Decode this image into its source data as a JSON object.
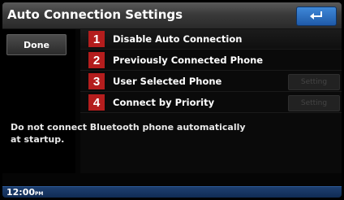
{
  "header": {
    "title": "Auto Connection Settings",
    "back_icon": "return-arrow-icon"
  },
  "sidebar": {
    "done_label": "Done"
  },
  "options": [
    {
      "number": "1",
      "label": "Disable Auto Connection",
      "setting": ""
    },
    {
      "number": "2",
      "label": "Previously Connected Phone",
      "setting": ""
    },
    {
      "number": "3",
      "label": "User Selected Phone",
      "setting": "Setting"
    },
    {
      "number": "4",
      "label": "Connect by Priority",
      "setting": "Setting"
    }
  ],
  "description": "Do not connect Bluetooth phone automatically at startup.",
  "status": {
    "time": "12:00",
    "ampm": "PM"
  },
  "colors": {
    "number_badge": "#b41d1d",
    "title_bar": "#3a3a3a",
    "status_bar": "#1e3f6f",
    "back_button": "#2f72c4"
  }
}
